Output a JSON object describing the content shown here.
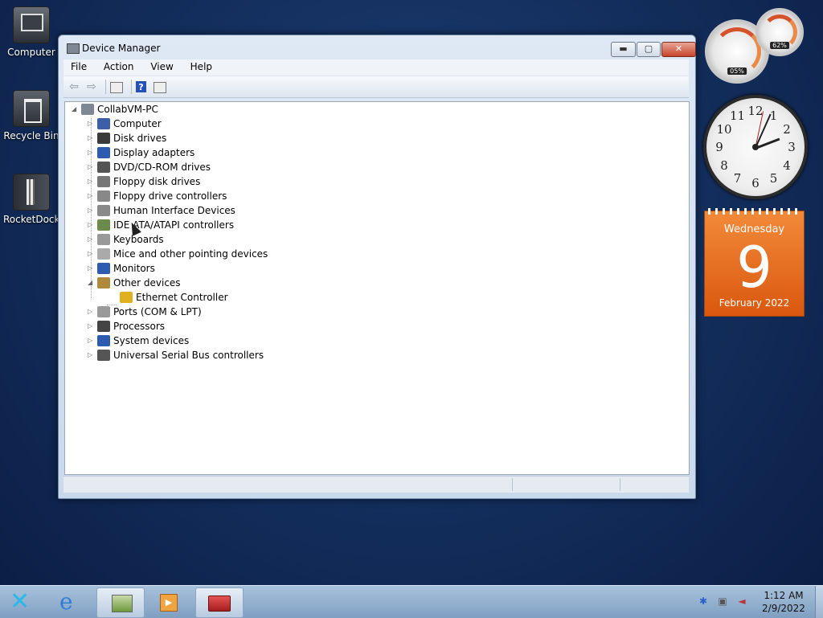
{
  "desktop": {
    "icons": [
      {
        "label": "Computer"
      },
      {
        "label": "Recycle Bin"
      },
      {
        "label": "RocketDock"
      }
    ]
  },
  "window": {
    "title": "Device Manager",
    "buttons": {
      "minimize": "▬",
      "maximize": "▢",
      "close": "✕"
    },
    "menu": [
      "File",
      "Action",
      "View",
      "Help"
    ],
    "tree": {
      "root": "CollabVM-PC",
      "items": [
        {
          "label": "Computer",
          "icon": "computer-icon",
          "color": "#3c5fa8"
        },
        {
          "label": "Disk drives",
          "icon": "disk-drive-icon",
          "color": "#3a3a3a"
        },
        {
          "label": "Display adapters",
          "icon": "display-adapter-icon",
          "color": "#2d5bb0"
        },
        {
          "label": "DVD/CD-ROM drives",
          "icon": "dvd-drive-icon",
          "color": "#555555"
        },
        {
          "label": "Floppy disk drives",
          "icon": "floppy-disk-icon",
          "color": "#777777"
        },
        {
          "label": "Floppy drive controllers",
          "icon": "floppy-controller-icon",
          "color": "#888888"
        },
        {
          "label": "Human Interface Devices",
          "icon": "hid-icon",
          "color": "#8a8a8a"
        },
        {
          "label": "IDE ATA/ATAPI controllers",
          "icon": "ide-controller-icon",
          "color": "#6c8a4a"
        },
        {
          "label": "Keyboards",
          "icon": "keyboard-icon",
          "color": "#999999"
        },
        {
          "label": "Mice and other pointing devices",
          "icon": "mouse-icon",
          "color": "#aaaaaa"
        },
        {
          "label": "Monitors",
          "icon": "monitor-icon",
          "color": "#2d5bb0"
        },
        {
          "label": "Other devices",
          "icon": "other-devices-icon",
          "color": "#b08a3a",
          "expanded": true
        },
        {
          "label": "Ports (COM & LPT)",
          "icon": "port-icon",
          "color": "#9a9a9a"
        },
        {
          "label": "Processors",
          "icon": "processor-icon",
          "color": "#444444"
        },
        {
          "label": "System devices",
          "icon": "system-devices-icon",
          "color": "#2d5bb0"
        },
        {
          "label": "Universal Serial Bus controllers",
          "icon": "usb-icon",
          "color": "#555555"
        }
      ],
      "child_of_other": {
        "label": "Ethernet Controller",
        "icon": "warning-device-icon",
        "color": "#e0b020"
      }
    }
  },
  "gadgets": {
    "cpu_meter": {
      "cpu": "05%",
      "memory": "62%"
    },
    "clock": {
      "numerals": [
        "12",
        "1",
        "2",
        "3",
        "4",
        "5",
        "6",
        "7",
        "8",
        "9",
        "10",
        "11"
      ]
    },
    "calendar": {
      "weekday": "Wednesday",
      "day": "9",
      "month_year": "February 2022"
    }
  },
  "taskbar": {
    "time": "1:12 AM",
    "date": "2/9/2022"
  }
}
